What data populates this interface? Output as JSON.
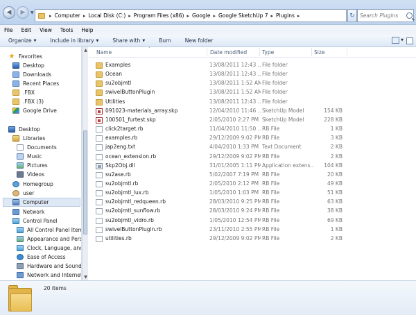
{
  "address": {
    "crumbs": [
      "Computer",
      "Local Disk (C:)",
      "Program Files (x86)",
      "Google",
      "Google SketchUp 7",
      "Plugins"
    ]
  },
  "search": {
    "placeholder": "Search Plugins"
  },
  "menu": [
    "File",
    "Edit",
    "View",
    "Tools",
    "Help"
  ],
  "commands": {
    "organize": "Organize",
    "include_in_library": "Include in library",
    "share_with": "Share with",
    "burn": "Burn",
    "new_folder": "New folder"
  },
  "navpane": {
    "favorites": "Favorites",
    "favorites_items": [
      "Desktop",
      "Downloads",
      "Recent Places",
      ".FBX",
      ".FBX (3)",
      "Google Drive"
    ],
    "desktop": "Desktop",
    "libraries": "Libraries",
    "library_items": [
      "Documents",
      "Music",
      "Pictures",
      "Videos"
    ],
    "homegroup": "Homegroup",
    "user": "user",
    "computer": "Computer",
    "network": "Network",
    "control_panel": "Control Panel",
    "control_panel_items": [
      "All Control Panel Items",
      "Appearance and Person",
      "Clock, Language, and F",
      "Ease of Access",
      "Hardware and Sound",
      "Network and Internet"
    ]
  },
  "columns": {
    "name": "Name",
    "date": "Date modified",
    "type": "Type",
    "size": "Size"
  },
  "files": [
    {
      "name": "Examples",
      "date": "13/08/2011 12:43 ...",
      "type": "File folder",
      "size": "",
      "icon": "folder"
    },
    {
      "name": "Ocean",
      "date": "13/08/2011 12:43 ...",
      "type": "File folder",
      "size": "",
      "icon": "folder"
    },
    {
      "name": "su2objmtl",
      "date": "13/08/2011 1:52 AM",
      "type": "File folder",
      "size": "",
      "icon": "folder"
    },
    {
      "name": "swivelButtonPlugin",
      "date": "13/08/2011 1:52 AM",
      "type": "File folder",
      "size": "",
      "icon": "folder"
    },
    {
      "name": "Utilities",
      "date": "13/08/2011 12:43 ...",
      "type": "File folder",
      "size": "",
      "icon": "folder"
    },
    {
      "name": "091023-materials_array.skp",
      "date": "12/04/2010 11:46 ...",
      "type": "SketchUp Model",
      "size": "154 KB",
      "icon": "skp"
    },
    {
      "name": "100501_furtest.skp",
      "date": "2/05/2010 2:27 PM",
      "type": "SketchUp Model",
      "size": "228 KB",
      "icon": "skp"
    },
    {
      "name": "click2target.rb",
      "date": "11/04/2010 11:50 ...",
      "type": "RB File",
      "size": "1 KB",
      "icon": "rb"
    },
    {
      "name": "examples.rb",
      "date": "29/12/2009 9:02 PM",
      "type": "RB File",
      "size": "3 KB",
      "icon": "rb"
    },
    {
      "name": "jap2eng.txt",
      "date": "4/04/2010 1:33 PM",
      "type": "Text Document",
      "size": "2 KB",
      "icon": "txt"
    },
    {
      "name": "ocean_extension.rb",
      "date": "29/12/2009 9:02 PM",
      "type": "RB File",
      "size": "2 KB",
      "icon": "rb"
    },
    {
      "name": "Skp2Obj.dll",
      "date": "31/01/2005 1:11 PM",
      "type": "Application extens...",
      "size": "104 KB",
      "icon": "dll"
    },
    {
      "name": "su2ase.rb",
      "date": "5/02/2007 7:19 PM",
      "type": "RB File",
      "size": "20 KB",
      "icon": "rb"
    },
    {
      "name": "su2objmtl.rb",
      "date": "2/05/2010 2:12 PM",
      "type": "RB File",
      "size": "49 KB",
      "icon": "rb"
    },
    {
      "name": "su2objmtl_lux.rb",
      "date": "1/05/2010 1:03 PM",
      "type": "RB File",
      "size": "51 KB",
      "icon": "rb"
    },
    {
      "name": "su2objmtl_redqueen.rb",
      "date": "28/03/2010 9:25 PM",
      "type": "RB File",
      "size": "63 KB",
      "icon": "rb"
    },
    {
      "name": "su2objmtl_sunflow.rb",
      "date": "28/03/2010 9:24 PM",
      "type": "RB File",
      "size": "38 KB",
      "icon": "rb"
    },
    {
      "name": "su2objmtl_vidro.rb",
      "date": "1/05/2010 12:54 PM",
      "type": "RB File",
      "size": "69 KB",
      "icon": "rb"
    },
    {
      "name": "swivelButtonPlugin.rb",
      "date": "23/11/2010 2:55 PM",
      "type": "RB File",
      "size": "1 KB",
      "icon": "rb"
    },
    {
      "name": "utilities.rb",
      "date": "29/12/2009 9:02 PM",
      "type": "RB File",
      "size": "2 KB",
      "icon": "rb"
    }
  ],
  "details": {
    "item_count": "20 items"
  }
}
